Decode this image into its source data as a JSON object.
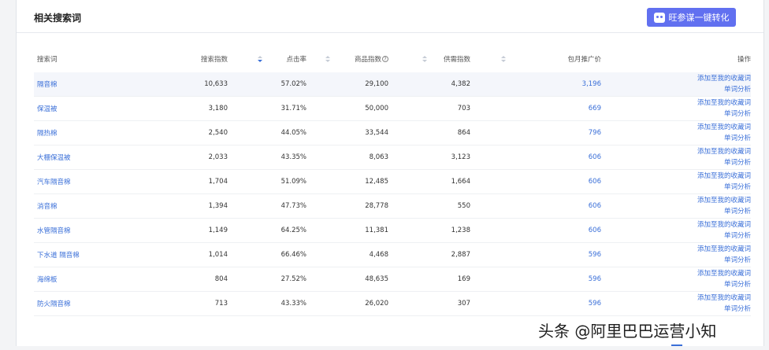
{
  "panel": {
    "title": "相关搜索词",
    "convert_button": "旺参谋一键转化"
  },
  "table": {
    "headers": {
      "keyword": "搜索词",
      "search_index": "搜索指数",
      "ctr": "点击率",
      "product_index": "商品指数",
      "supply_demand": "供需指数",
      "monthly_price": "包月推广价",
      "actions": "操作"
    },
    "rows": [
      {
        "keyword": "隔音棉",
        "search_index": "10,633",
        "ctr": "57.02%",
        "product_index": "29,100",
        "supply_demand": "4,382",
        "price": "3,196",
        "add": "添加至我的收藏词",
        "analyze": "单词分析"
      },
      {
        "keyword": "保温被",
        "search_index": "3,180",
        "ctr": "31.71%",
        "product_index": "50,000",
        "supply_demand": "703",
        "price": "669",
        "add": "添加至我的收藏词",
        "analyze": "单词分析"
      },
      {
        "keyword": "隔热棉",
        "search_index": "2,540",
        "ctr": "44.05%",
        "product_index": "33,544",
        "supply_demand": "864",
        "price": "796",
        "add": "添加至我的收藏词",
        "analyze": "单词分析"
      },
      {
        "keyword": "大棚保温被",
        "search_index": "2,033",
        "ctr": "43.35%",
        "product_index": "8,063",
        "supply_demand": "3,123",
        "price": "606",
        "add": "添加至我的收藏词",
        "analyze": "单词分析"
      },
      {
        "keyword": "汽车隔音棉",
        "search_index": "1,704",
        "ctr": "51.09%",
        "product_index": "12,485",
        "supply_demand": "1,664",
        "price": "606",
        "add": "添加至我的收藏词",
        "analyze": "单词分析"
      },
      {
        "keyword": "消音棉",
        "search_index": "1,394",
        "ctr": "47.73%",
        "product_index": "28,778",
        "supply_demand": "550",
        "price": "606",
        "add": "添加至我的收藏词",
        "analyze": "单词分析"
      },
      {
        "keyword": "水管隔音棉",
        "search_index": "1,149",
        "ctr": "64.25%",
        "product_index": "11,381",
        "supply_demand": "1,238",
        "price": "606",
        "add": "添加至我的收藏词",
        "analyze": "单词分析"
      },
      {
        "keyword": "下水道 隔音棉",
        "search_index": "1,014",
        "ctr": "66.46%",
        "product_index": "4,468",
        "supply_demand": "2,887",
        "price": "596",
        "add": "添加至我的收藏词",
        "analyze": "单词分析"
      },
      {
        "keyword": "海绵板",
        "search_index": "804",
        "ctr": "27.52%",
        "product_index": "48,635",
        "supply_demand": "169",
        "price": "596",
        "add": "添加至我的收藏词",
        "analyze": "单词分析"
      },
      {
        "keyword": "防火隔音棉",
        "search_index": "713",
        "ctr": "43.33%",
        "product_index": "26,020",
        "supply_demand": "307",
        "price": "596",
        "add": "添加至我的收藏词",
        "analyze": "单词分析"
      }
    ]
  },
  "watermark": "头条 @阿里巴巴运营小知",
  "colors": {
    "accent": "#6170f0",
    "link": "#3a6fd8",
    "highlight_row": "#f4f6fb"
  }
}
